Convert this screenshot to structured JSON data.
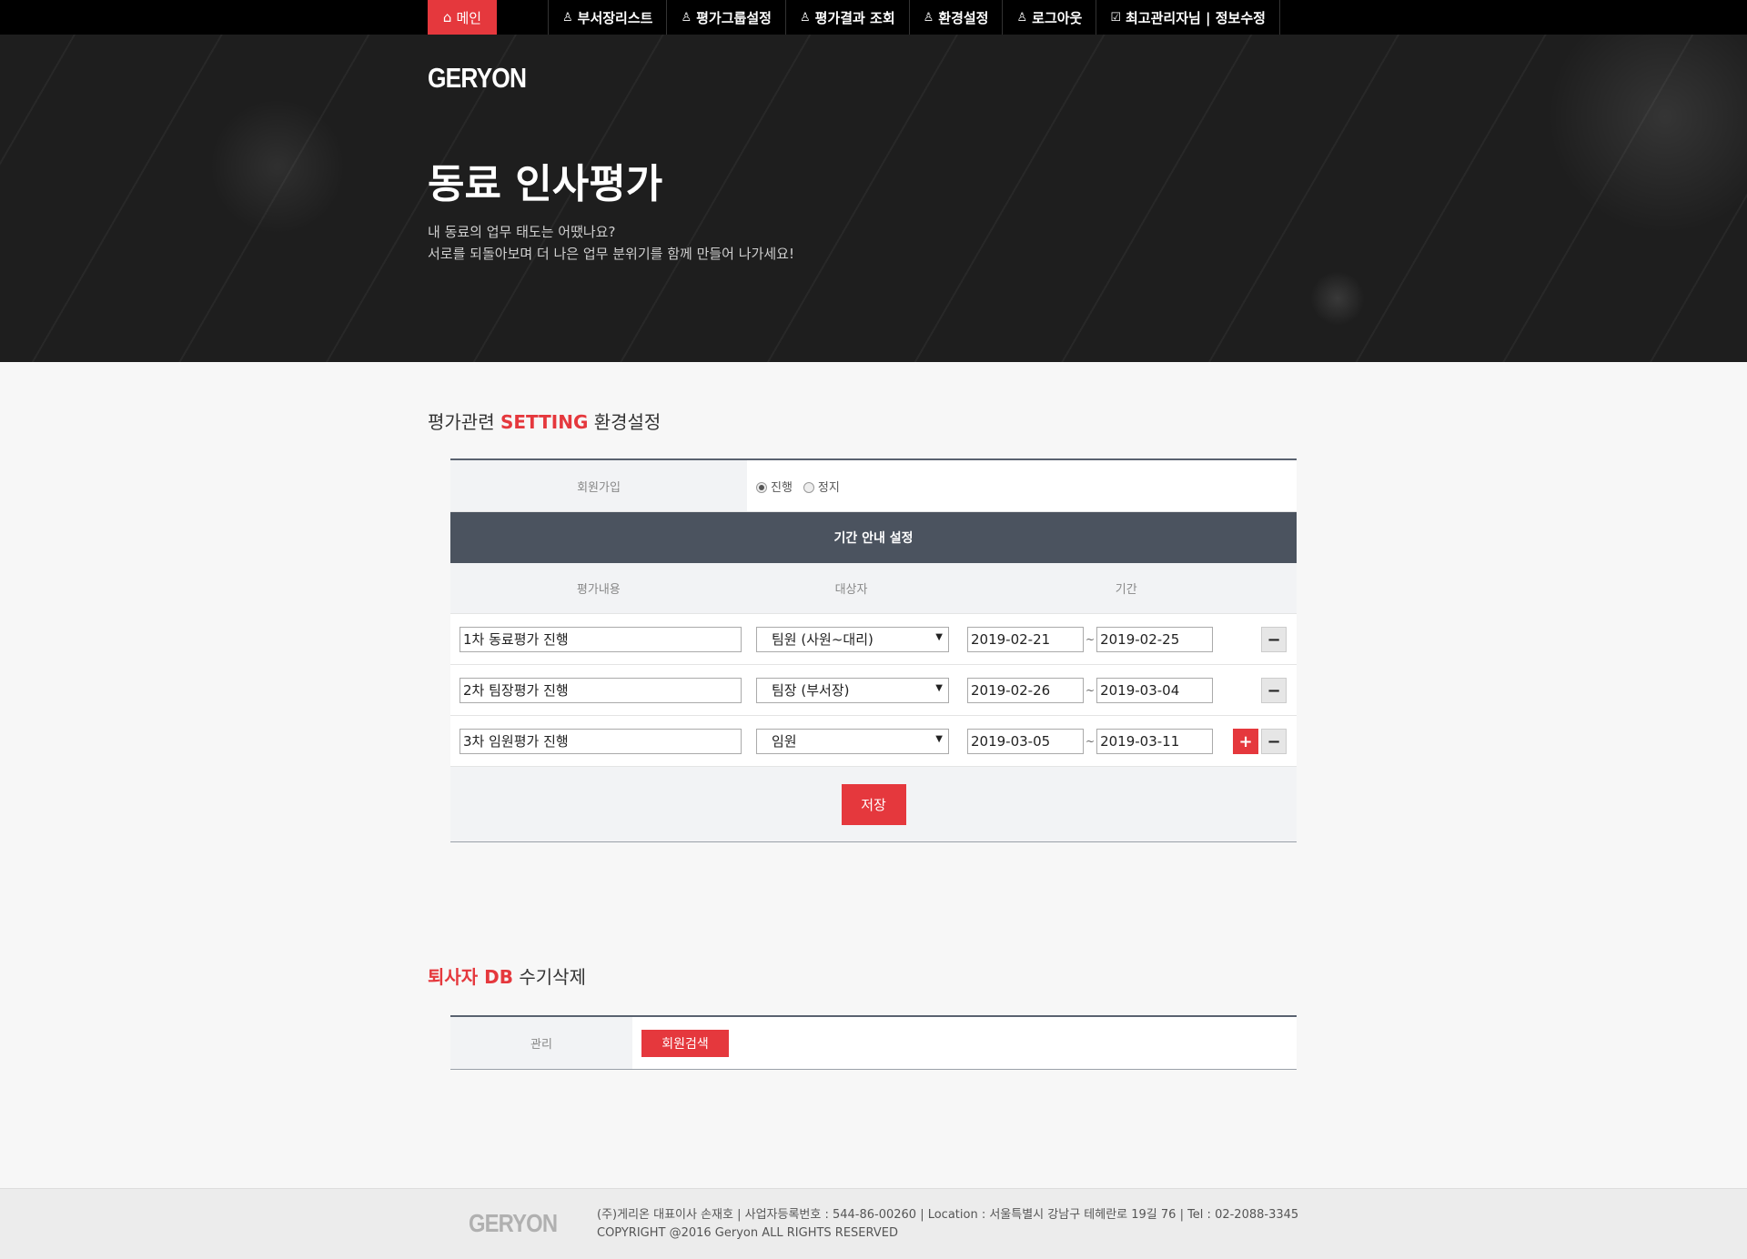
{
  "nav": {
    "home_label": "메인",
    "items": [
      {
        "label": "부서장리스트",
        "icon": "person-icon"
      },
      {
        "label": "평가그룹설정",
        "icon": "person-icon"
      },
      {
        "label": "평가결과 조회",
        "icon": "person-icon"
      },
      {
        "label": "환경설정",
        "icon": "person-icon"
      },
      {
        "label": "로그아웃",
        "icon": "person-icon"
      },
      {
        "label": "최고관리자님 | 정보수정",
        "icon": "clipboard-check-icon"
      }
    ]
  },
  "hero": {
    "logo": "GERYON",
    "title": "동료 인사평가",
    "desc_line1": "내 동료의 업무 태도는 어땠나요?",
    "desc_line2": "서로를 되돌아보며 더 나은 업무 분위기를 함께 만들어 나가세요!"
  },
  "setting": {
    "title_prefix": "평가관련 ",
    "title_red": "SETTING",
    "title_suffix": " 환경설정",
    "join_label": "회원가입",
    "radio_on_label": "진행",
    "radio_off_label": "정지",
    "period_header": "기간 안내 설정",
    "col_content": "평가내용",
    "col_target": "대상자",
    "col_period": "기간",
    "rows": [
      {
        "content": "1차 동료평가 진행",
        "target": "팀원 (사원~대리)",
        "start": "2019-02-21",
        "end": "2019-02-25"
      },
      {
        "content": "2차 팀장평가 진행",
        "target": "팀장 (부서장)",
        "start": "2019-02-26",
        "end": "2019-03-04"
      },
      {
        "content": "3차 임원평가 진행",
        "target": "임원",
        "start": "2019-03-05",
        "end": "2019-03-11"
      }
    ],
    "tilde": "~",
    "plus": "+",
    "minus": "−",
    "save_label": "저장"
  },
  "retire": {
    "title_red": "퇴사자 DB",
    "title_suffix": " 수기삭제",
    "manage_label": "관리",
    "search_button": "회원검색"
  },
  "footer": {
    "logo": "GERYON",
    "info_line1": "(주)게리온 대표이사 손재호 | 사업자등록번호 : 544-86-00260 | Location : 서울특별시 강남구 테헤란로 19길 76 | Tel : 02-2088-3345",
    "info_line2": "COPYRIGHT @2016 Geryon ALL RIGHTS RESERVED"
  },
  "colors": {
    "accent": "#e5383d",
    "topbar": "#000000",
    "hero_bg": "#1e1e1e",
    "panel_header": "#4b535f"
  }
}
